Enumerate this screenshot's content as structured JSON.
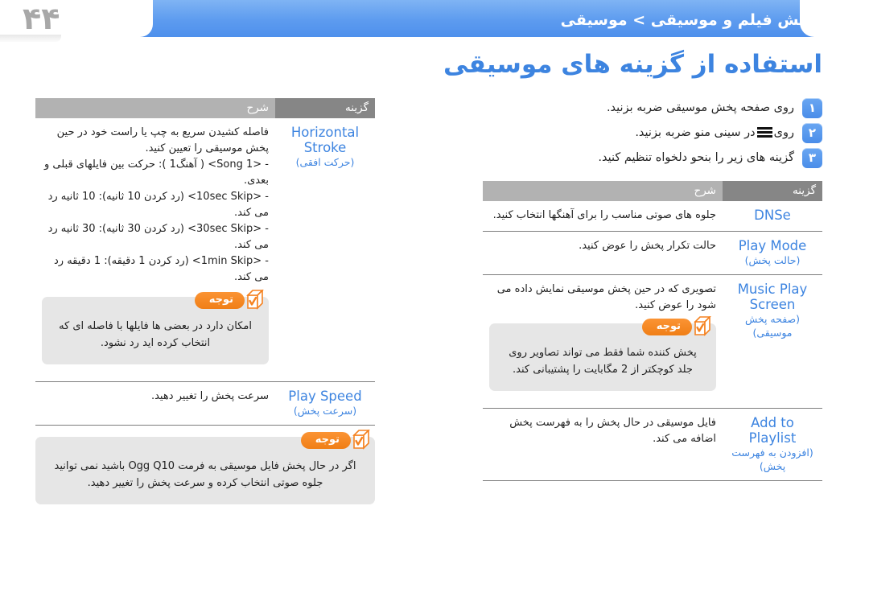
{
  "page": {
    "number": "۴۴",
    "breadcrumb": "پخش فیلم و موسیقی > موسیقی",
    "title": "استفاده از گزینه های موسیقی",
    "accent_blue": "#3d84e0",
    "header_blue": "#5d9bef",
    "note_orange": "#f58220",
    "header_gray_dark": "#868686",
    "header_gray_light": "#b2b2b2"
  },
  "steps": [
    {
      "badge": "۱",
      "text": "روی صفحه پخش موسیقی ضربه بزنید."
    },
    {
      "badge": "۲",
      "text_before": "روی",
      "icon": "hamburger-menu-icon",
      "text_after": "در سینی منو ضربه بزنید."
    },
    {
      "badge": "۳",
      "text": "گزینه های زیر را بنحو دلخواه تنظیم کنید."
    }
  ],
  "right_table": {
    "headers": {
      "option": "گزینه",
      "description": "شرح"
    },
    "rows": [
      {
        "option_en": "DNSe",
        "option_fa": "",
        "description": "جلوه های صوتی مناسب را برای آهنگها انتخاب کنید."
      },
      {
        "option_en": "Play Mode",
        "option_fa": "(حالت پخش)",
        "description": "حالت تکرار پخش را عوض کنید."
      },
      {
        "option_en": "Music Play Screen",
        "option_fa": "(صفحه پخش موسیقی)",
        "description": "تصویری که در حین پخش موسیقی نمایش داده می شود را عوض کنید."
      },
      {
        "option_en": "Add to Playlist",
        "option_fa": "(افزودن به فهرست پخش)",
        "description": "فایل موسیقی در حال پخش را به فهرست پخش اضافه می کند."
      }
    ],
    "note": {
      "label": "توجه",
      "text": "پخش کننده شما فقط می تواند تصاویر روی جلد کوچکتر از 2 مگابایت را پشتیبانی کند."
    }
  },
  "left_table": {
    "headers": {
      "option": "گزینه",
      "description": "شرح"
    },
    "rows": [
      {
        "option_en": "Horizontal Stroke",
        "option_fa": "(حرکت افقی)",
        "description_intro": "فاصله کشیدن سریع به چپ یا راست خود در حین پخش موسیقی را تعیین کنید.",
        "bullets": [
          "- <1 Song> ( آهنگ1 ): حرکت بین فایلهای قبلی و بعدی.",
          "- <10sec Skip> (رد کردن 10 ثانیه): 10 ثانیه رد می کند.",
          "- <30sec Skip> (رد کردن 30 ثانیه): 30 ثانیه رد می کند.",
          "- <1min Skip> (رد کردن 1 دقیقه): 1 دقیقه رد می کند."
        ]
      },
      {
        "option_en": "Play Speed",
        "option_fa": "(سرعت پخش)",
        "description_intro": "سرعت پخش را تغییر دهید.",
        "bullets": []
      }
    ],
    "note_1": {
      "label": "توجه",
      "text": "امکان دارد در بعضی ها فایلها با فاصله ای که انتخاب کرده اید رد نشود."
    },
    "note_2": {
      "label": "توجه",
      "text": "اگر در حال پخش فایل موسیقی به فرمت Ogg Q10 باشید نمی توانید جلوه صوتی انتخاب کرده و سرعت پخش را تغییر دهید."
    }
  }
}
